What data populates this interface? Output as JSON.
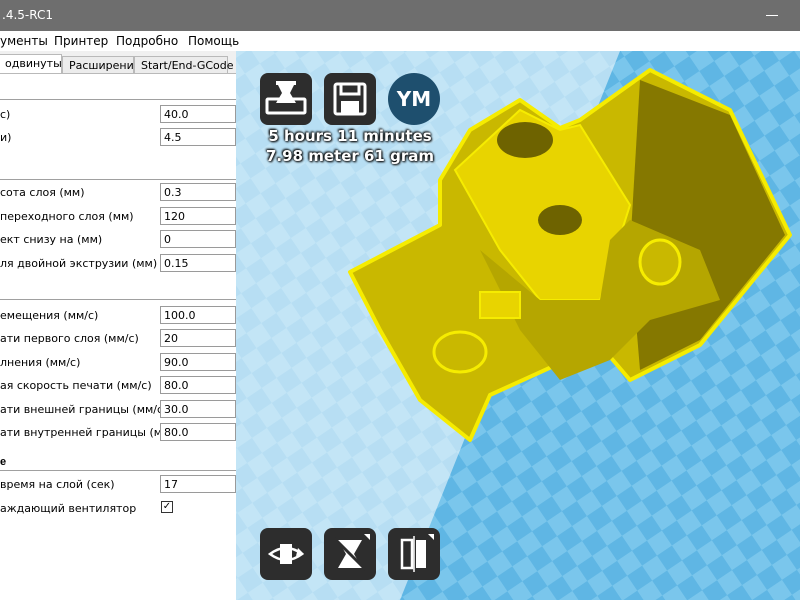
{
  "window": {
    "title": ".4.5-RC1"
  },
  "menu": [
    "ументы",
    "Принтер",
    "Подробно",
    "Помощь"
  ],
  "tabs": [
    "одвинутые",
    "Расширения",
    "Start/End-GCode"
  ],
  "settings": {
    "group1": [
      {
        "label": "с)",
        "value": "40.0"
      },
      {
        "label": "и)",
        "value": "4.5"
      }
    ],
    "group2": [
      {
        "label": "сота слоя (мм)",
        "value": "0.3"
      },
      {
        "label": "переходного слоя (мм)",
        "value": "120"
      },
      {
        "label": "ект снизу на (мм)",
        "value": "0"
      },
      {
        "label": "ля двойной экструзии (мм)",
        "value": "0.15"
      }
    ],
    "group3": [
      {
        "label": "емещения (мм/с)",
        "value": "100.0"
      },
      {
        "label": "ати первого слоя (мм/с)",
        "value": "20"
      },
      {
        "label": "лнения (мм/с)",
        "value": "90.0"
      },
      {
        "label": "ая скорость печати (мм/с)",
        "value": "80.0"
      },
      {
        "label": "ати внешней границы (мм/с)",
        "value": "30.0"
      },
      {
        "label": "ати внутренней границы (мм/с)",
        "value": "80.0"
      }
    ],
    "cool_section": "е",
    "group4": [
      {
        "label": "время на слой (сек)",
        "value": "17"
      }
    ],
    "fan_label": "аждающий вентилятор",
    "fan_check": "✓"
  },
  "viewport": {
    "ym_label": "YM",
    "time_text": "5 hours 11 minutes",
    "material_text": "7.98 meter 61 gram"
  },
  "colors": {
    "model_yellow": "#e8d400",
    "model_dark": "#857800",
    "bed_blue": "#5fb6e4"
  }
}
